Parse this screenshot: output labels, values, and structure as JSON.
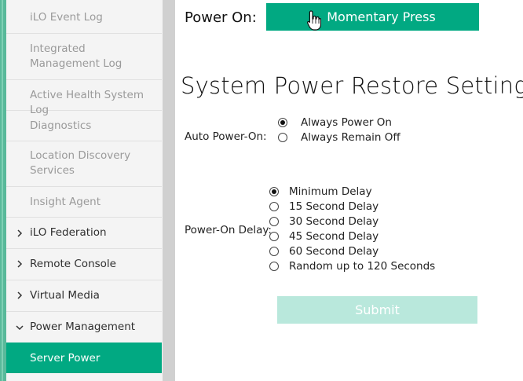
{
  "sidebar": {
    "items": [
      {
        "label": "iLO Event Log",
        "type": "child"
      },
      {
        "label": "Integrated Management Log",
        "type": "child"
      },
      {
        "label": "Active Health System Log",
        "type": "child"
      },
      {
        "label": "Diagnostics",
        "type": "child"
      },
      {
        "label": "Location Discovery Services",
        "type": "child"
      },
      {
        "label": "Insight Agent",
        "type": "child"
      },
      {
        "label": "iLO Federation",
        "type": "collapsed",
        "icon": "chevron-right-icon"
      },
      {
        "label": "Remote Console",
        "type": "collapsed",
        "icon": "chevron-right-icon"
      },
      {
        "label": "Virtual Media",
        "type": "collapsed",
        "icon": "chevron-right-icon"
      },
      {
        "label": "Power Management",
        "type": "expanded",
        "icon": "chevron-down-icon"
      },
      {
        "label": "Server Power",
        "type": "active"
      }
    ],
    "colors": {
      "accent": "#01a982",
      "muted_text": "#9a9a9a"
    }
  },
  "power_on": {
    "label": "Power On:",
    "button_label": "Momentary Press"
  },
  "restore": {
    "title": "System Power Restore Settings",
    "auto_power_on": {
      "label": "Auto Power-On:",
      "options": [
        "Always Power On",
        "Always Remain Off"
      ],
      "selected": "Always Power On"
    },
    "power_on_delay": {
      "label": "Power-On Delay:",
      "options": [
        "Minimum Delay",
        "15 Second Delay",
        "30 Second Delay",
        "45 Second Delay",
        "60 Second Delay",
        "Random up to 120 Seconds"
      ],
      "selected": "Minimum Delay"
    },
    "submit_label": "Submit"
  }
}
